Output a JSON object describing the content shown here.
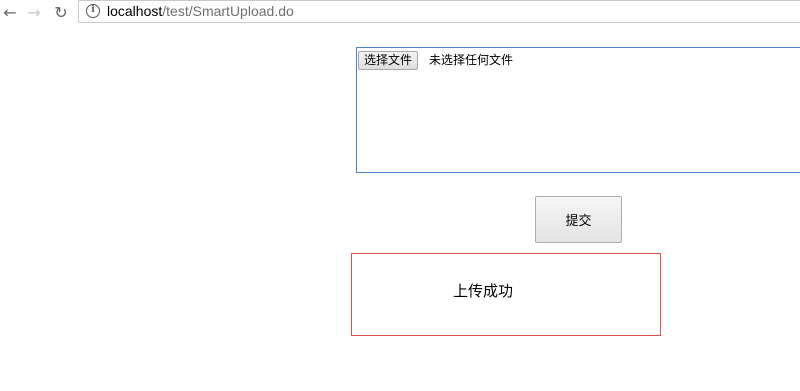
{
  "browser": {
    "back_icon": "arrow-left-icon",
    "forward_icon": "arrow-right-icon",
    "reload_icon": "reload-icon",
    "info_icon": "info-icon",
    "url_host": "localhost",
    "url_path": "/test/SmartUpload.do"
  },
  "upload": {
    "choose_file_label": "选择文件",
    "file_status": "未选择任何文件"
  },
  "form": {
    "submit_label": "提交"
  },
  "result": {
    "message": "上传成功"
  },
  "colors": {
    "upload_border": "#4a86c8",
    "result_border": "#e05050"
  }
}
